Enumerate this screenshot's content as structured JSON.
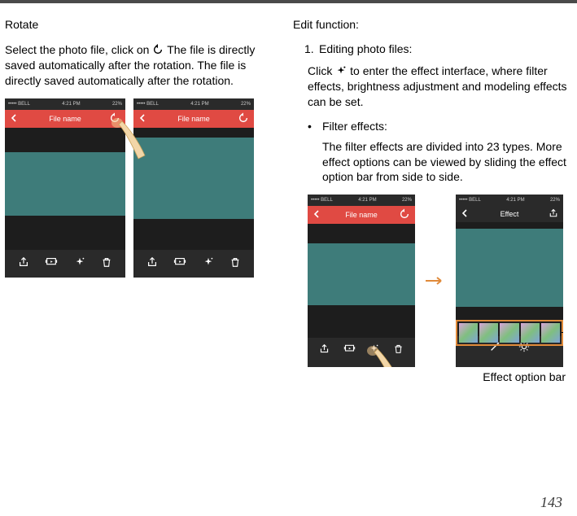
{
  "page_number": "143",
  "left": {
    "heading": "Rotate",
    "para1a": "Select the photo file, click on ",
    "para1b": " The file is directly saved automatically after the rotation. The file is directly saved automatically after the rotation.",
    "phone_status_left": "••••• BELL",
    "phone_status_time": "4:21 PM",
    "phone_status_batt": "22%",
    "phone_header_title": "File name"
  },
  "right": {
    "heading": "Edit function:",
    "item1_num": "1.",
    "item1_title": "Editing photo files:",
    "item1_body_a": "Click ",
    "item1_body_b": " to enter the effect interface, where filter effects, brightness adjustment and modeling effects can be set.",
    "filter_label": "Filter effects:",
    "filter_body": "The filter effects are divided into 23 types. More effect options can be viewed by sliding the effect option bar from side to side.",
    "phone_header_title_file": "File name",
    "phone_header_title_effect": "Effect",
    "phone_status_left": "••••• BELL",
    "phone_status_time": "4:21 PM",
    "phone_status_batt": "22%",
    "effect_label": "Effect option bar",
    "bullet_dot": "•"
  }
}
